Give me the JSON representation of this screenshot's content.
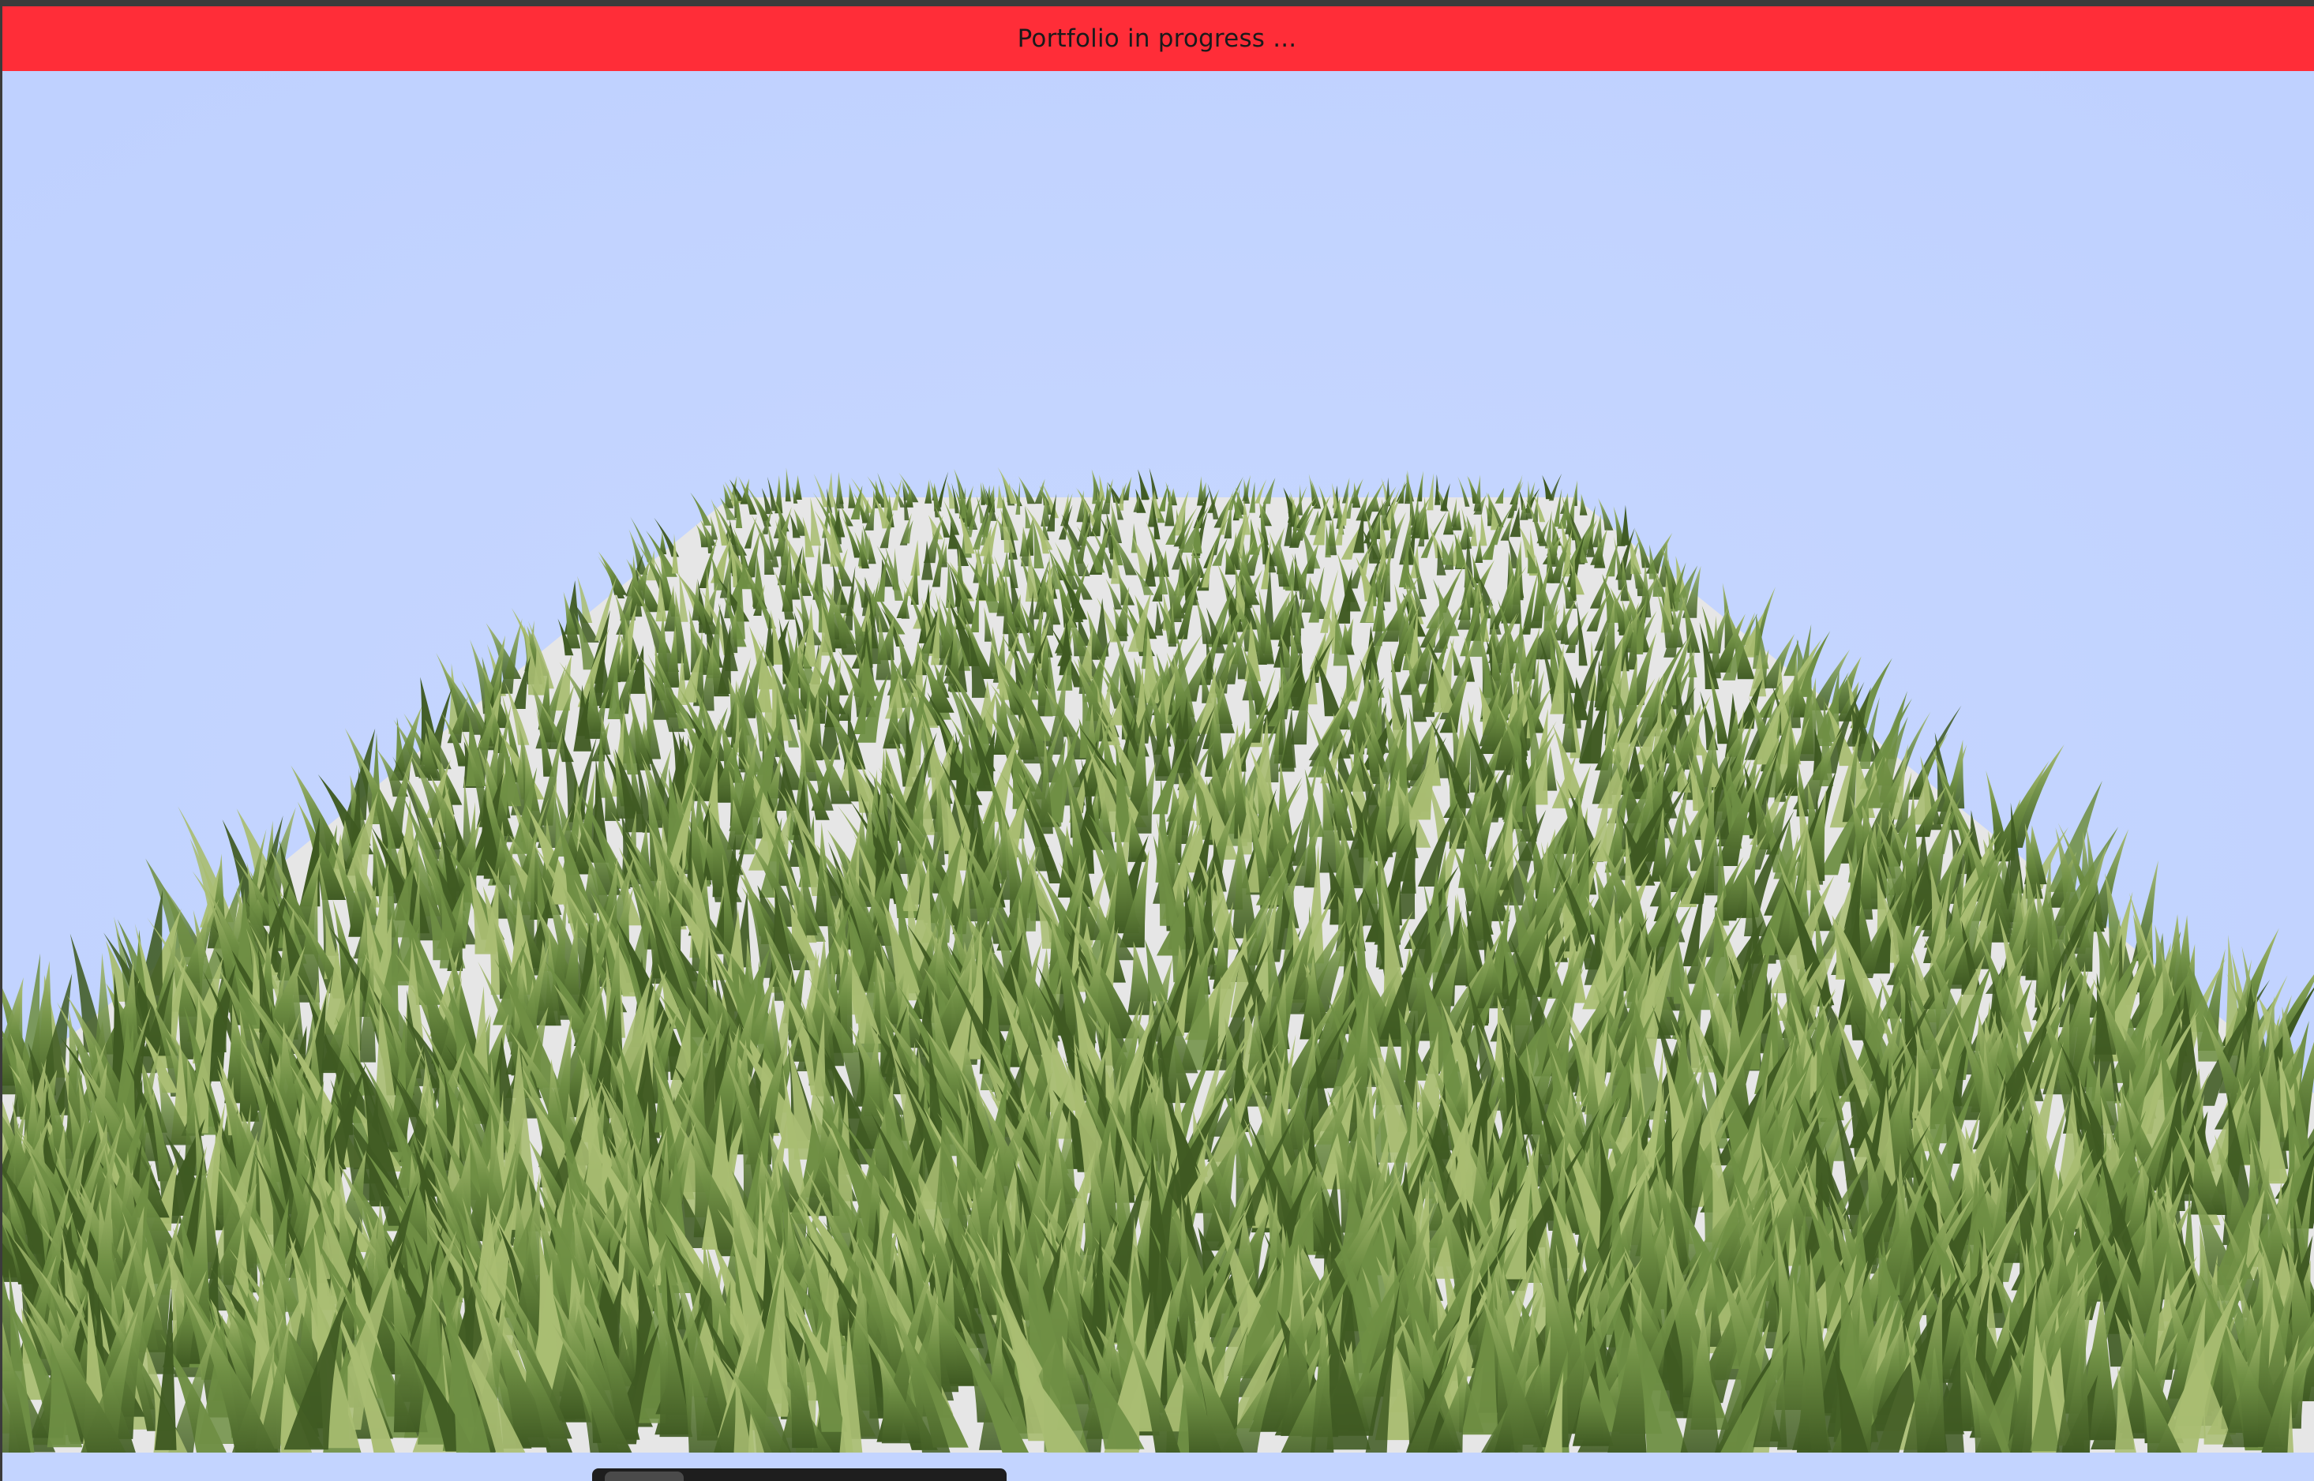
{
  "banner": {
    "text": "Portfolio in progress ...",
    "background_color": "#ff2d38",
    "text_color": "#1a1a1a"
  },
  "scene": {
    "sky_color": "#c3d4ff",
    "ground_color": "#e6e6e6",
    "grass_colors": {
      "dark": "#3f5a22",
      "mid": "#6f8f44",
      "light": "#a9bd72"
    },
    "icons": [
      "grass-field-icon"
    ]
  },
  "controls": {
    "bar_color": "#1e1e1e",
    "knob_color": "#4a4a4a"
  }
}
